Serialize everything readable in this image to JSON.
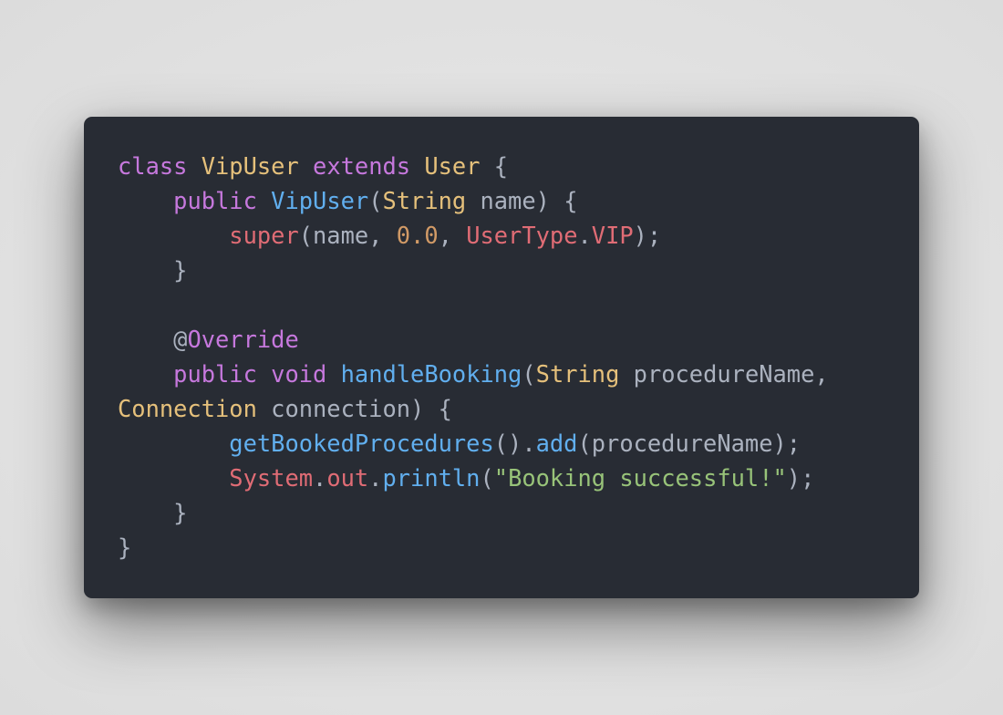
{
  "code_snippet": {
    "language": "java",
    "theme_colors": {
      "background": "#282c34",
      "plain": "#abb2bf",
      "keyword": "#c678dd",
      "type": "#e5c07b",
      "function": "#61afef",
      "red": "#e06c75",
      "number": "#d19a66",
      "string": "#98c379"
    },
    "lines": [
      {
        "tokens": [
          {
            "t": "class",
            "k": "keyword"
          },
          {
            "t": " ",
            "k": "plain"
          },
          {
            "t": "VipUser",
            "k": "type"
          },
          {
            "t": " ",
            "k": "plain"
          },
          {
            "t": "extends",
            "k": "keyword"
          },
          {
            "t": " ",
            "k": "plain"
          },
          {
            "t": "User",
            "k": "type"
          },
          {
            "t": " {",
            "k": "plain"
          }
        ]
      },
      {
        "tokens": [
          {
            "t": "    ",
            "k": "plain"
          },
          {
            "t": "public",
            "k": "keyword"
          },
          {
            "t": " ",
            "k": "plain"
          },
          {
            "t": "VipUser",
            "k": "func"
          },
          {
            "t": "(",
            "k": "plain"
          },
          {
            "t": "String",
            "k": "type"
          },
          {
            "t": " name) {",
            "k": "plain"
          }
        ]
      },
      {
        "tokens": [
          {
            "t": "        ",
            "k": "plain"
          },
          {
            "t": "super",
            "k": "red"
          },
          {
            "t": "(name, ",
            "k": "plain"
          },
          {
            "t": "0.0",
            "k": "number"
          },
          {
            "t": ", ",
            "k": "plain"
          },
          {
            "t": "UserType",
            "k": "red"
          },
          {
            "t": ".",
            "k": "plain"
          },
          {
            "t": "VIP",
            "k": "red"
          },
          {
            "t": ");",
            "k": "plain"
          }
        ]
      },
      {
        "tokens": [
          {
            "t": "    }",
            "k": "plain"
          }
        ]
      },
      {
        "tokens": []
      },
      {
        "tokens": [
          {
            "t": "    @",
            "k": "plain"
          },
          {
            "t": "Override",
            "k": "keyword"
          }
        ]
      },
      {
        "tokens": [
          {
            "t": "    ",
            "k": "plain"
          },
          {
            "t": "public",
            "k": "keyword"
          },
          {
            "t": " ",
            "k": "plain"
          },
          {
            "t": "void",
            "k": "keyword"
          },
          {
            "t": " ",
            "k": "plain"
          },
          {
            "t": "handleBooking",
            "k": "func"
          },
          {
            "t": "(",
            "k": "plain"
          },
          {
            "t": "String",
            "k": "type"
          },
          {
            "t": " procedureName,",
            "k": "plain"
          }
        ]
      },
      {
        "tokens": [
          {
            "t": "Connection",
            "k": "type"
          },
          {
            "t": " connection) {",
            "k": "plain"
          }
        ]
      },
      {
        "tokens": [
          {
            "t": "        ",
            "k": "plain"
          },
          {
            "t": "getBookedProcedures",
            "k": "func"
          },
          {
            "t": "().",
            "k": "plain"
          },
          {
            "t": "add",
            "k": "func"
          },
          {
            "t": "(procedureName);",
            "k": "plain"
          }
        ]
      },
      {
        "tokens": [
          {
            "t": "        ",
            "k": "plain"
          },
          {
            "t": "System",
            "k": "red"
          },
          {
            "t": ".",
            "k": "plain"
          },
          {
            "t": "out",
            "k": "red"
          },
          {
            "t": ".",
            "k": "plain"
          },
          {
            "t": "println",
            "k": "func"
          },
          {
            "t": "(",
            "k": "plain"
          },
          {
            "t": "\"Booking successful!\"",
            "k": "string"
          },
          {
            "t": ");",
            "k": "plain"
          }
        ]
      },
      {
        "tokens": [
          {
            "t": "    }",
            "k": "plain"
          }
        ]
      },
      {
        "tokens": [
          {
            "t": "}",
            "k": "plain"
          }
        ]
      }
    ]
  }
}
